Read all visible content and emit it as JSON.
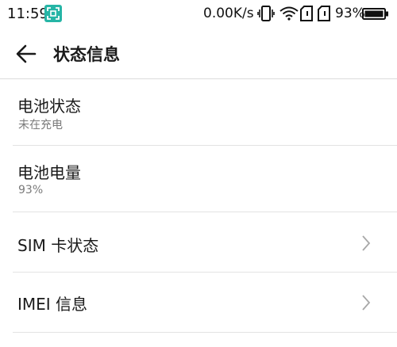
{
  "status_bar": {
    "time": "11:59",
    "net_speed": "0.00K/s",
    "battery_percent": "93%",
    "icons": [
      "screenshot-icon",
      "vibrate-icon",
      "wifi-icon",
      "sim-card-icon",
      "sim-card-icon",
      "battery-icon"
    ],
    "accent_color": "#26b5a6"
  },
  "header": {
    "title": "状态信息",
    "back_icon": "back-arrow-icon"
  },
  "list": {
    "items": [
      {
        "title": "电池状态",
        "subtitle": "未在充电"
      },
      {
        "title": "电池电量",
        "subtitle": "93%"
      },
      {
        "title": "SIM 卡状态",
        "icon": "chevron-right-icon"
      },
      {
        "title": "IMEI 信息",
        "icon": "chevron-right-icon"
      }
    ]
  }
}
